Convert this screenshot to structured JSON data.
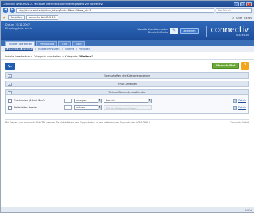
{
  "browser": {
    "title": "Connectiv WebCMS 4.0 - Microsoft Internet Explorer bereitgestellt von connectiv!",
    "url": "http://der.connectiv.de/admin_kat.php?cid=18&kat=1&nav_id=10",
    "search_placeholder": "Live Search",
    "tabs": [
      "Favoriten",
      "connectiv WebCMS 4.0"
    ],
    "tools": [
      "Seite",
      "Extras"
    ],
    "status_text": "",
    "zoom": "100%"
  },
  "header": {
    "user_lines": [
      "Datum: 21.11.2007",
      "Eingeloggt als: admin"
    ],
    "website_text": [
      "Website direkt bearbeiten",
      "Directedit-Modus"
    ],
    "logout_label": "abmelden",
    "logo": "connectiv",
    "logo_sub": "WebCMS 4.0"
  },
  "main_tabs": [
    "Inhalte bearbeiten",
    "Verwaltung",
    "Eins",
    "Zwei"
  ],
  "sub_nav": [
    "Kategorien anlegen",
    "Inhalte verwalten",
    "Zugriffe",
    "Vorlagen"
  ],
  "breadcrumb": {
    "path": "Inhalte bearbeiten > Kategorie bearbeiten > Kategorie",
    "current": "\"Weitere\""
  },
  "actions": {
    "back_icon": "arrow-left-icon",
    "next_label": "Neuer Artikel",
    "help_icon": "question-icon"
  },
  "sections": [
    {
      "title": "Eigenschaften der Kategorie anzeigen",
      "toggle": "+"
    },
    {
      "title": "Inhalt anzeigen",
      "toggle": "+"
    },
    {
      "title": "Weitere Elemente a usblenden",
      "toggle": "-"
    }
  ],
  "extra_rows": [
    {
      "label": "Geschichten (Artikel Menü)",
      "sel1": "anzeigen",
      "sel2": "Beispiel",
      "link": "Details"
    },
    {
      "label": "Weiterleiten Header",
      "sel1": "aktiviert",
      "sel2": "URL der Kategorie eintragen",
      "link": "Details"
    }
  ],
  "footer": {
    "text": "Bei Fragen zum connectiv WebCMS wenden Sie sich bitte an den Support oder an den telefonischen Support unter 0049 0999 9",
    "right": "Connectiv GmbH"
  },
  "colors": {
    "header_blue": "#2f68b8",
    "next_green": "#6da938",
    "help_orange": "#f2a61b"
  }
}
